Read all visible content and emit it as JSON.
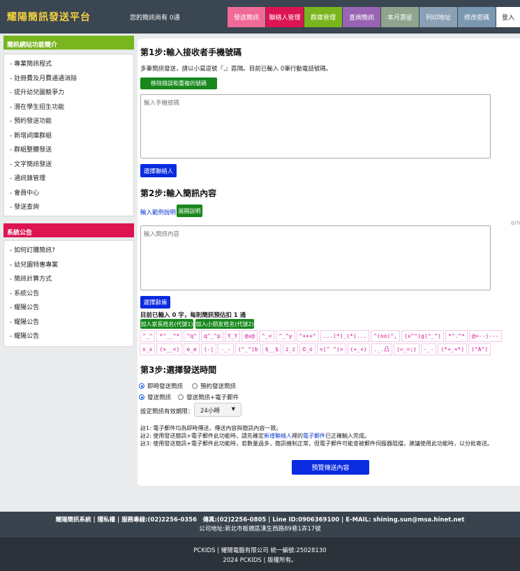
{
  "header": {
    "logo": "耀陽簡訊發送平台",
    "quota": "您的簡訊尚有 0通",
    "nav": [
      {
        "label": "發送簡訊",
        "color": "#f06a97"
      },
      {
        "label": "聯絡人管理",
        "color": "#dc1452"
      },
      {
        "label": "群庫管理",
        "color": "#7ab51d"
      },
      {
        "label": "查詢簡訊",
        "color": "#9a64b4"
      },
      {
        "label": "本月壽星",
        "color": "#8fa38d"
      },
      {
        "label": "列印地址",
        "color": "#8aa0b4"
      },
      {
        "label": "修改密碼",
        "color": "#7b98b1"
      }
    ],
    "login": "登入"
  },
  "sidebar": {
    "features_title": "簡訊網站功能簡介",
    "features": [
      "專業簡訊程式",
      "註冊費及月費通通消除",
      "提升幼兒園競爭力",
      "潛在學生招生功能",
      "預約發送功能",
      "新增詞庫群組",
      "群組整體發送",
      "文字簡訊發送",
      "通訊錄管理",
      "會員中心",
      "發送查詢"
    ],
    "news_title": "系統公告",
    "news": [
      "如何訂購簡訊?",
      "幼兒園特惠專案",
      "簡訊計算方式",
      "系統公告",
      "耀陽公告",
      "耀陽公告",
      "耀陽公告"
    ]
  },
  "step1": {
    "title": "第1步:輸入接收者手機號碼",
    "hint": "多筆簡訊發送，請以小寫逗號『,』區隔。目前已輸入 0筆行動電話號碼。",
    "remove_btn": "移除錯誤和重複的號碼",
    "phone_placeholder": "輸入手機號碼",
    "choose_btn": "選擇聯絡人"
  },
  "step2": {
    "title": "第2步:輸入簡訊內容",
    "example_link": "輸入範例說明",
    "expand_btn": "展開說明",
    "counter": "0/70",
    "content_placeholder": "輸入簡訊內容",
    "choose_btn": "選擇辭庫",
    "status": "目前已輸入 0 字，每則簡訊預估扣 1 通",
    "insert_parent": "加入家長姓名(代號1)",
    "insert_child": "加入小朋友姓名(代號2)",
    "emoticons": [
      "^_^",
      "*^__^*",
      "^q^",
      "q^_^p",
      "Y_Y",
      "@x@",
      "^_<",
      "^_^y",
      "^+++^",
      "...(*)_(*)...",
      "^(oo)^,",
      "(x^^)g(^_^)",
      "*^.^*",
      "@>--)---",
      "x_x",
      "(>__<)",
      "e_e",
      "(-|",
      "-_-",
      "(^_^)b",
      "$__$",
      "z_z",
      "O_o",
      "<(\" \")>",
      "(+_+)",
      "._.凸",
      "(=_=;)",
      "-_-",
      "(*+_+*)",
      "(^A^)"
    ]
  },
  "step3": {
    "title": "第3步:選擇發送時間",
    "opt_now": "即時發送簡訊",
    "opt_schedule": "預約發送簡訊",
    "opt_sms": "發送簡訊",
    "opt_sms_email": "發送簡訊+電子郵件",
    "validity_label": "設定簡訊有效期限：",
    "validity_value": "24小時",
    "note1": "註1: 電子郵件均為即時傳送，傳送內容與簡訊內容一致。",
    "note2_pre": "註2: 使用發送簡訊+電子郵件此功能時，請先確定",
    "note2_link1": "新增聯絡人",
    "note2_mid": "裡的",
    "note2_link2": "電子郵件",
    "note2_post": "已正確輸入完成。",
    "note3": "註3: 使用發送簡訊+電子郵件此功能時，若數量過多，簡訊機制正常，但電子郵件可能會被郵件伺服器阻擋，建議使用此功能時，以分批寄送。",
    "preview_btn": "預覽傳送內容"
  },
  "footer": {
    "line1": "耀陽簡訊系統 | 隱私權 | 服務專線:(02)2256-0356　傳真:(02)2256-0805 | Line ID:0906369100 | E-MAIL: shining.sun@msa.hinet.net",
    "line2": "公司地址:新北市板橋區漢生西路89巷1弄17號",
    "line3": "PCKIDS | 耀陽電腦有限公司 統一編號:25028130",
    "line4": "2024 PCKIDS | 版權所有。"
  }
}
